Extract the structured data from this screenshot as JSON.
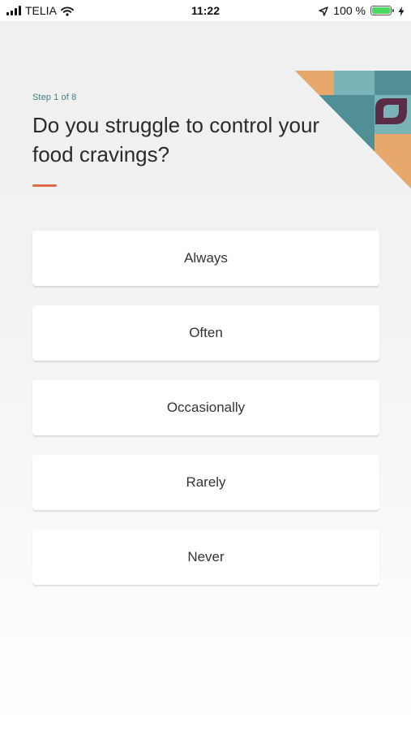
{
  "status_bar": {
    "carrier": "TELIA",
    "time": "11:22",
    "battery_text": "100 %",
    "battery_level": 1.0,
    "icons": [
      "signal-icon",
      "wifi-icon",
      "location-arrow-icon",
      "battery-icon",
      "charging-bolt-icon"
    ]
  },
  "quiz": {
    "step": "Step 1 of 8",
    "question": "Do you struggle to control your food cravings?",
    "options": [
      "Always",
      "Often",
      "Occasionally",
      "Rarely",
      "Never"
    ]
  },
  "colors": {
    "accent": "#e0694c",
    "step_text": "#3f7d83",
    "battery_green": "#4cd964",
    "deco_orange": "#e8a86b",
    "deco_teal": "#4f8f95",
    "deco_teal_light": "#7ab4b8",
    "deco_plum": "#5b2c45"
  }
}
